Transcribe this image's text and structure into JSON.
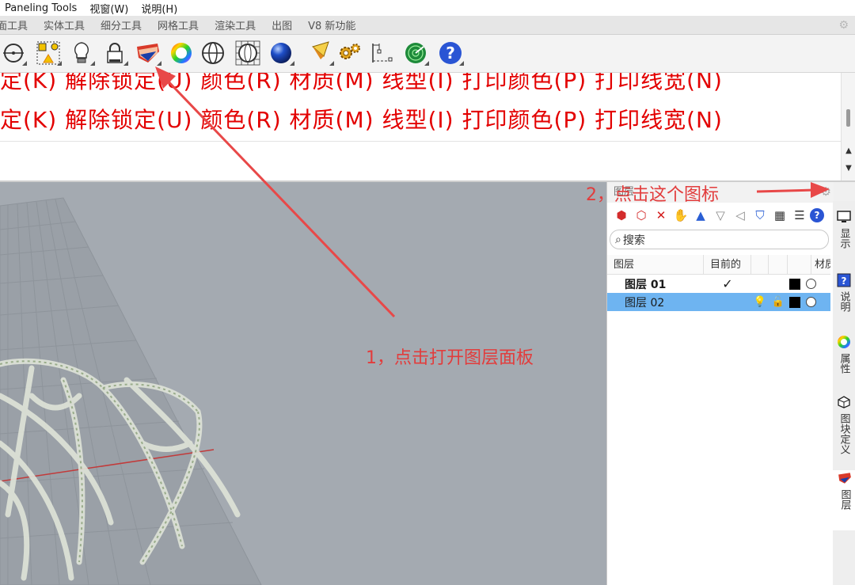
{
  "menubar": {
    "items": [
      "Paneling Tools",
      "视窗(W)",
      "说明(H)"
    ]
  },
  "tabs": [
    "面工具",
    "实体工具",
    "细分工具",
    "网格工具",
    "渲染工具",
    "出图",
    "V8 新功能"
  ],
  "command": {
    "line1": "定(K)  解除锁定(U)  颜色(R)  材质(M)  线型(I)  打印颜色(P)  打印线宽(N)",
    "line2": "定(K)  解除锁定(U)  颜色(R)  材质(M)  线型(I)  打印颜色(P)  打印线宽(N)"
  },
  "toolbar": {
    "icons": [
      "osnap-circle-icon",
      "group-icon",
      "lightbulb-icon",
      "lock-icon",
      "layer-icon",
      "color-wheel-icon",
      "sphere-wireframe-icon",
      "mesh-sphere-icon",
      "blue-sphere-icon",
      "render-icon",
      "settings-gear-icon",
      "dimension-icon",
      "radar-icon",
      "help-icon"
    ]
  },
  "panel": {
    "title": "图层",
    "search_placeholder": "搜索",
    "columns": [
      "图层",
      "目前的",
      "",
      "",
      "材质"
    ],
    "layers": [
      {
        "name": "图层 01",
        "current": "✓",
        "color": "#000000"
      },
      {
        "name": "图层 02",
        "current": "",
        "color": "#000000"
      }
    ]
  },
  "sidetabs": [
    "显示",
    "说明",
    "属性",
    "图块定义",
    "图层"
  ],
  "annotations": {
    "step1": "1，点击打开图层面板",
    "step2": "2，点击这个图标"
  },
  "colors": {
    "annotation": "#e23c3c",
    "command_text": "#e30000",
    "selection": "#6eb4f1",
    "viewport": "#a4aab1"
  }
}
